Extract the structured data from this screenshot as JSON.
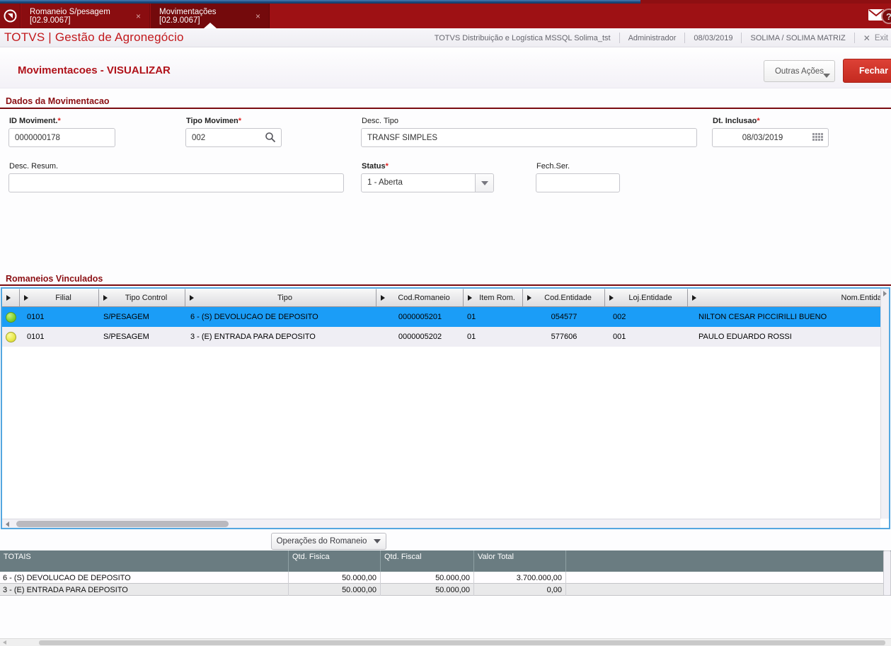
{
  "topbar": {
    "tabs": [
      {
        "label": "Romaneio S/pesagem [02.9.0067]",
        "close_glyph": "×",
        "active": false
      },
      {
        "label": "Movimentações [02.9.0067]",
        "close_glyph": "×",
        "active": true
      }
    ]
  },
  "header": {
    "brand": "TOTVS | Gestão de Agronegócio",
    "environment": "TOTVS Distribuição e Logística MSSQL Solima_tst",
    "user": "Administrador",
    "date": "08/03/2019",
    "company": "SOLIMA / SOLIMA MATRIZ",
    "exit_glyph": "✕",
    "exit_label": "Exit",
    "help_glyph": "?"
  },
  "page": {
    "title": "Movimentacoes - VISUALIZAR",
    "other_actions_label": "Outras Ações",
    "close_label": "Fechar"
  },
  "form": {
    "section_title": "Dados da Movimentacao",
    "required_mark": "*",
    "fields": {
      "id_moviment": {
        "label": "ID Moviment.",
        "required": true,
        "value": "0000000178"
      },
      "tipo_movimen": {
        "label": "Tipo Movimen",
        "required": true,
        "value": "002"
      },
      "desc_tipo": {
        "label": "Desc. Tipo",
        "required": false,
        "value": "TRANSF SIMPLES"
      },
      "dt_inclusao": {
        "label": "Dt. Inclusao",
        "required": true,
        "value": "08/03/2019"
      },
      "desc_resum": {
        "label": "Desc. Resum.",
        "required": false,
        "value": ""
      },
      "status": {
        "label": "Status",
        "required": true,
        "value": "1 - Aberta"
      },
      "fech_ser": {
        "label": "Fech.Ser.",
        "required": false,
        "value": ""
      }
    }
  },
  "grid": {
    "section_title": "Romaneios Vinculados",
    "columns": [
      "Filial",
      "Tipo Control",
      "Tipo",
      "Cod.Romaneio",
      "Item Rom.",
      "Cod.Entidade",
      "Loj.Entidade",
      "Nom.Entida"
    ],
    "rows": [
      {
        "status": "green",
        "selected": true,
        "filial": "0101",
        "tipo_control": "S/PESAGEM",
        "tipo": "6 - (S) DEVOLUCAO DE DEPOSITO",
        "cod_romaneio": "0000005201",
        "item_rom": "01",
        "cod_entidade": "054577",
        "loj_entidade": "002",
        "nom_entidade": "NILTON CESAR PICCIRILLI BUENO"
      },
      {
        "status": "yellow",
        "selected": false,
        "filial": "0101",
        "tipo_control": "S/PESAGEM",
        "tipo": "3 - (E) ENTRADA PARA DEPOSITO",
        "cod_romaneio": "0000005202",
        "item_rom": "01",
        "cod_entidade": "577606",
        "loj_entidade": "001",
        "nom_entidade": "PAULO EDUARDO ROSSI"
      }
    ],
    "operations_button": "Operações do Romaneio"
  },
  "totals": {
    "columns": [
      "TOTAIS",
      "Qtd. Fisica",
      "Qtd. Fiscal",
      "Valor Total"
    ],
    "rows": [
      {
        "label": "6 - (S) DEVOLUCAO DE DEPOSITO",
        "qtd_fisica": "50.000,00",
        "qtd_fiscal": "50.000,00",
        "valor_total": "3.700.000,00"
      },
      {
        "label": "3 - (E) ENTRADA PARA DEPOSITO",
        "qtd_fisica": "50.000,00",
        "qtd_fiscal": "50.000,00",
        "valor_total": "0,00"
      }
    ]
  },
  "colors": {
    "topbar_red": "#9e1114",
    "active_tab_red": "#740a0c",
    "brand_red": "#c2181c",
    "title_red": "#b0121a",
    "rule_red": "#7a0b10",
    "close_button_red": "#c42a20",
    "selected_row_blue": "#1b9df7",
    "grid_border_blue": "#54a7e0",
    "totals_header_gray": "#6a7c81",
    "status_green": "#7fcf2e",
    "status_yellow": "#e8e84a"
  }
}
